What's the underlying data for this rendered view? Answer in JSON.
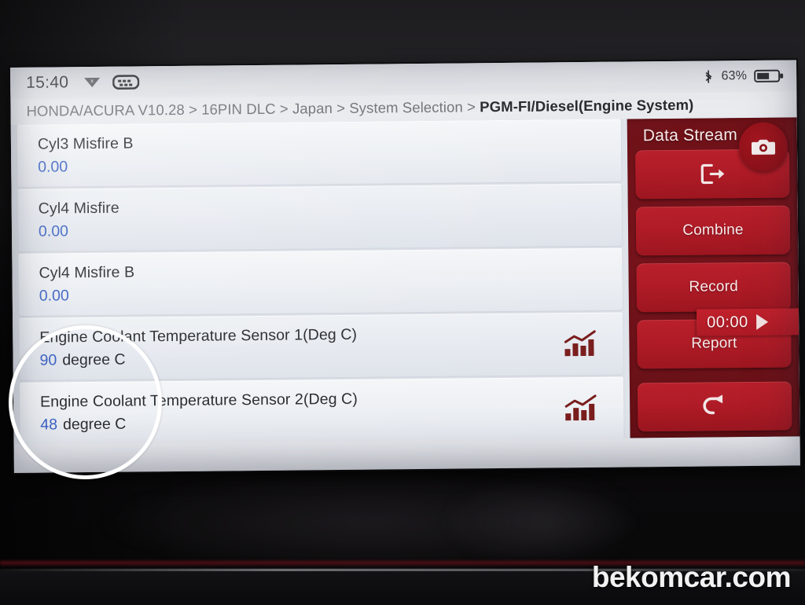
{
  "statusbar": {
    "time": "15:40",
    "bluetooth_icon": "bluetooth-icon",
    "battery_percent": "63%",
    "battery_icon": "battery-icon",
    "left_icon_1": "cast-off-icon",
    "left_icon_2": "obd-connector-icon"
  },
  "breadcrumb": {
    "path": "HONDA/ACURA V10.28 > 16PIN DLC > Japan > System Selection > ",
    "current": "PGM-FI/Diesel(Engine System)"
  },
  "list": {
    "rows": [
      {
        "name": "Cyl3 Misfire B",
        "value": "0.00",
        "unit": "",
        "has_chart": false
      },
      {
        "name": "Cyl4 Misfire",
        "value": "0.00",
        "unit": "",
        "has_chart": false
      },
      {
        "name": "Cyl4 Misfire B",
        "value": "0.00",
        "unit": "",
        "has_chart": false
      },
      {
        "name": "Engine Coolant Temperature Sensor 1(Deg C)",
        "value": "90",
        "unit": "degree C",
        "has_chart": true
      },
      {
        "name": "Engine Coolant Temperature Sensor 2(Deg C)",
        "value": "48",
        "unit": "degree C",
        "has_chart": true
      }
    ]
  },
  "sidebar": {
    "title": "Data Stream",
    "camera_icon": "camera-icon",
    "exit_icon": "exit-icon",
    "combine_label": "Combine",
    "record_label": "Record",
    "report_label": "Report",
    "back_icon": "back-arrow-icon",
    "timer": "00:00",
    "play_icon": "play-icon"
  },
  "annotation": {
    "circle": "highlight-circle"
  },
  "watermark": {
    "text": "bekomcar.com"
  },
  "colors": {
    "panel_bg": "#6f1118",
    "button_red": "#b9202b",
    "value_blue": "#3b62c4",
    "chart_icon": "#7a1e1e",
    "screen_bg": "#e7e9ee"
  }
}
